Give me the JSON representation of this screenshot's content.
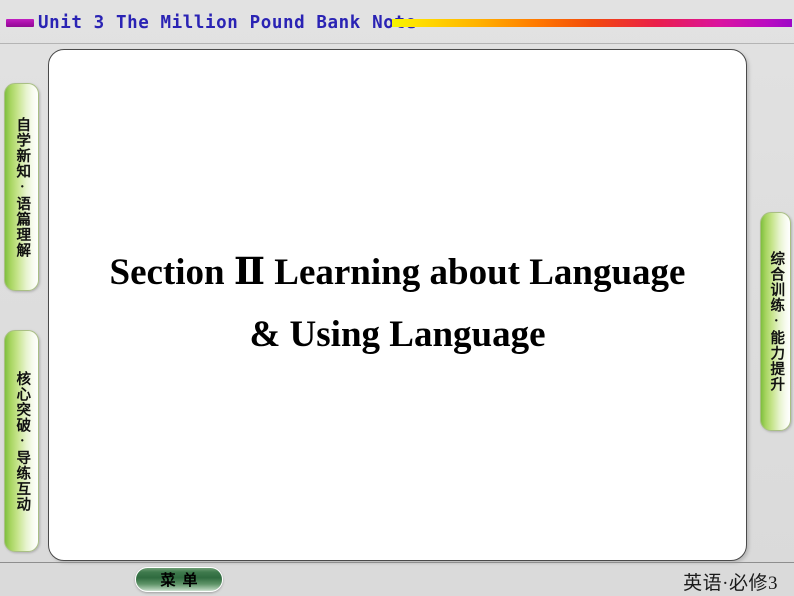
{
  "header": {
    "dash_icon": "purple-dash-icon",
    "title": "Unit 3  The Million Pound Bank Note",
    "title_color": "#2a23b4",
    "gradient_icon": "rainbow-gradient-bar",
    "gradient_colors": [
      "#f5f500",
      "#ffb000",
      "#f24a0c",
      "#ea1f4a",
      "#da13a0",
      "#9d07c6"
    ]
  },
  "panel": {
    "title_line1": "Section Ⅱ    Learning about Language",
    "title_line2": "& Using Language",
    "background": "#ffffff",
    "border_color": "#4a4a4a"
  },
  "side_tabs": {
    "left": [
      {
        "label": "自学新知·语篇理解"
      },
      {
        "label": "核心突破·导练互动"
      }
    ],
    "right": [
      {
        "label": "综合训练·能力提升"
      }
    ],
    "accent": "#7fbf3f"
  },
  "footer": {
    "menu_label": "菜单",
    "menu_accent": "#2f6b3f",
    "edition": "英语·必修3"
  }
}
